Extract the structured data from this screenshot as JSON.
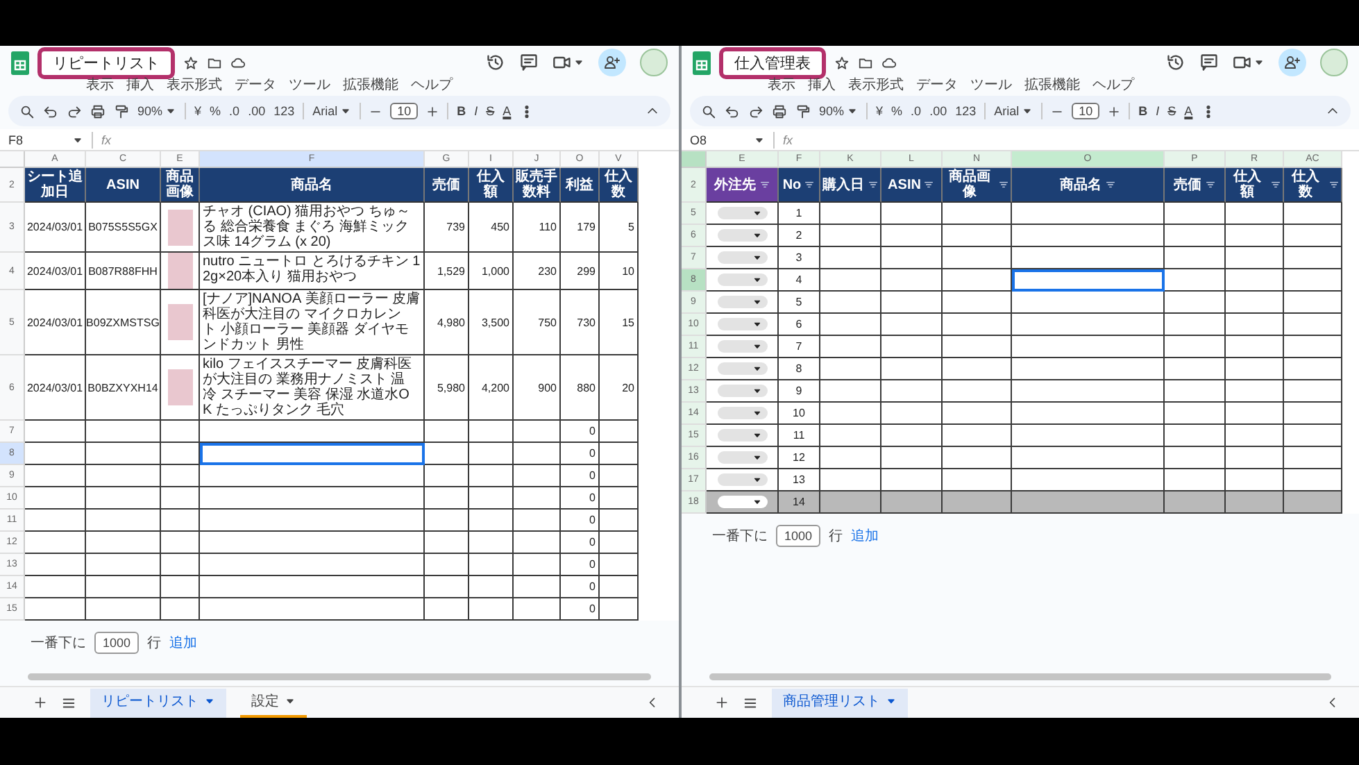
{
  "windows": [
    {
      "title": {
        "text": "リピートリスト",
        "highlighted": true
      },
      "menu": [
        "表示",
        "挿入",
        "表示形式",
        "データ",
        "ツール",
        "拡張機能",
        "ヘルプ"
      ],
      "toolbar": {
        "zoom": "90%",
        "currency": "¥",
        "percent": "%",
        "decrease_decimal": ".0",
        "increase_decimal": ".00",
        "number_format": "123",
        "font": "Arial",
        "font_size": "10",
        "bold": "B",
        "italic": "I",
        "strikethrough": "S",
        "text_color": "A"
      },
      "cell_ref": "F8",
      "fx": "fx",
      "filtered": false,
      "header_row": "2",
      "columns": [
        {
          "letter": "A",
          "header": "シート追加日",
          "kind": "center",
          "selected": false,
          "color": "#1c3f74"
        },
        {
          "letter": "C",
          "header": "ASIN",
          "kind": "center",
          "selected": false,
          "color": "#1c3f74"
        },
        {
          "letter": "E",
          "header": "商品画像",
          "kind": "image",
          "selected": false,
          "color": "#1c3f74"
        },
        {
          "letter": "F",
          "header": "商品名",
          "kind": "wrap",
          "selected": true,
          "color": "#1c3f74"
        },
        {
          "letter": "G",
          "header": "売価",
          "kind": "number",
          "selected": false,
          "color": "#1c3f74"
        },
        {
          "letter": "I",
          "header": "仕入額",
          "kind": "number",
          "selected": false,
          "color": "#1c3f74"
        },
        {
          "letter": "J",
          "header": "販売手数料",
          "kind": "number",
          "selected": false,
          "color": "#1c3f74"
        },
        {
          "letter": "O",
          "header": "利益",
          "kind": "number",
          "selected": false,
          "color": "#1c3f74"
        },
        {
          "letter": "V",
          "header": "仕入数",
          "kind": "number",
          "selected": false,
          "color": "#1c3f74"
        }
      ],
      "rows": [
        {
          "num": "3",
          "selected": false,
          "image": true,
          "cells": [
            "2024/03/01",
            "B075S5S5GX",
            null,
            "チャオ (CIAO) 猫用おやつ ちゅ～る 総合栄養食 まぐろ 海鮮ミックス味 14グラム (x 20)",
            "739",
            "450",
            "110",
            "179",
            "5"
          ]
        },
        {
          "num": "4",
          "selected": false,
          "image": true,
          "cells": [
            "2024/03/01",
            "B087R88FHH",
            null,
            "nutro ニュートロ とろけるチキン 12g×20本入り 猫用おやつ",
            "1,529",
            "1,000",
            "230",
            "299",
            "10"
          ]
        },
        {
          "num": "5",
          "selected": false,
          "image": true,
          "cells": [
            "2024/03/01",
            "B09ZXMSTSG",
            null,
            "[ナノア]NANOA 美顔ローラー 皮膚科医が大注目の マイクロカレント 小顔ローラー 美顔器 ダイヤモンドカット 男性",
            "4,980",
            "3,500",
            "750",
            "730",
            "15"
          ]
        },
        {
          "num": "6",
          "selected": false,
          "image": true,
          "cells": [
            "2024/03/01",
            "B0BZXYXH14",
            null,
            "kilo フェイススチーマー 皮膚科医が大注目の 業務用ナノミスト 温冷 スチーマー 美容 保湿 水道水OK たっぷりタンク 毛穴",
            "5,980",
            "4,200",
            "900",
            "880",
            "20"
          ]
        },
        {
          "num": "7",
          "selected": false,
          "cells": [
            null,
            null,
            null,
            null,
            null,
            null,
            null,
            "0",
            null
          ]
        },
        {
          "num": "8",
          "selected": true,
          "cells": [
            null,
            null,
            null,
            null,
            null,
            null,
            null,
            "0",
            null
          ]
        },
        {
          "num": "9",
          "selected": false,
          "cells": [
            null,
            null,
            null,
            null,
            null,
            null,
            null,
            "0",
            null
          ]
        },
        {
          "num": "10",
          "selected": false,
          "cells": [
            null,
            null,
            null,
            null,
            null,
            null,
            null,
            "0",
            null
          ]
        },
        {
          "num": "11",
          "selected": false,
          "cells": [
            null,
            null,
            null,
            null,
            null,
            null,
            null,
            "0",
            null
          ]
        },
        {
          "num": "12",
          "selected": false,
          "cells": [
            null,
            null,
            null,
            null,
            null,
            null,
            null,
            "0",
            null
          ]
        },
        {
          "num": "13",
          "selected": false,
          "cells": [
            null,
            null,
            null,
            null,
            null,
            null,
            null,
            "0",
            null
          ]
        },
        {
          "num": "14",
          "selected": false,
          "cells": [
            null,
            null,
            null,
            null,
            null,
            null,
            null,
            "0",
            null
          ]
        },
        {
          "num": "15",
          "selected": false,
          "cells": [
            null,
            null,
            null,
            null,
            null,
            null,
            null,
            "0",
            null
          ]
        }
      ],
      "add_rows": {
        "prefix": "一番下に",
        "count": "1000",
        "suffix": "行",
        "button": "追加"
      },
      "tabs": [
        {
          "label": "リピートリスト",
          "selected": true
        },
        {
          "label": "設定",
          "selected": false,
          "color": "#f29900"
        }
      ]
    },
    {
      "title": {
        "text": "仕入管理表",
        "highlighted": true
      },
      "menu": [
        "表示",
        "挿入",
        "表示形式",
        "データ",
        "ツール",
        "拡張機能",
        "ヘルプ"
      ],
      "toolbar": {
        "zoom": "90%",
        "currency": "¥",
        "percent": "%",
        "decrease_decimal": ".0",
        "increase_decimal": ".00",
        "number_format": "123",
        "font": "Arial",
        "font_size": "10",
        "bold": "B",
        "italic": "I",
        "strikethrough": "S",
        "text_color": "A"
      },
      "cell_ref": "O8",
      "fx": "fx",
      "filtered": true,
      "header_row": "2",
      "columns": [
        {
          "letter": "E",
          "header": "外注先",
          "kind": "dropdown",
          "selected": false,
          "color": "#6a3fa0"
        },
        {
          "letter": "F",
          "header": "No",
          "kind": "center",
          "selected": false,
          "color": "#1c3f74"
        },
        {
          "letter": "K",
          "header": "購入日",
          "kind": "center",
          "selected": false,
          "color": "#1c3f74"
        },
        {
          "letter": "L",
          "header": "ASIN",
          "kind": "center",
          "selected": false,
          "color": "#1c3f74"
        },
        {
          "letter": "N",
          "header": "商品画像",
          "kind": "image",
          "selected": false,
          "color": "#1c3f74"
        },
        {
          "letter": "O",
          "header": "商品名",
          "kind": "wrap",
          "selected": true,
          "color": "#1c3f74"
        },
        {
          "letter": "P",
          "header": "売価",
          "kind": "number",
          "selected": false,
          "color": "#1c3f74"
        },
        {
          "letter": "R",
          "header": "仕入額",
          "kind": "number",
          "selected": false,
          "color": "#1c3f74"
        },
        {
          "letter": "AC",
          "header": "仕入数",
          "kind": "number",
          "selected": false,
          "color": "#1c3f74"
        }
      ],
      "rows": [
        {
          "num": "5",
          "selected": false,
          "shaded": false,
          "cells": [
            null,
            "1",
            null,
            null,
            null,
            null,
            null,
            null,
            null
          ]
        },
        {
          "num": "6",
          "selected": false,
          "shaded": false,
          "cells": [
            null,
            "2",
            null,
            null,
            null,
            null,
            null,
            null,
            null
          ]
        },
        {
          "num": "7",
          "selected": false,
          "shaded": false,
          "cells": [
            null,
            "3",
            null,
            null,
            null,
            null,
            null,
            null,
            null
          ]
        },
        {
          "num": "8",
          "selected": true,
          "shaded": false,
          "cells": [
            null,
            "4",
            null,
            null,
            null,
            null,
            null,
            null,
            null
          ]
        },
        {
          "num": "9",
          "selected": false,
          "shaded": false,
          "cells": [
            null,
            "5",
            null,
            null,
            null,
            null,
            null,
            null,
            null
          ]
        },
        {
          "num": "10",
          "selected": false,
          "shaded": false,
          "cells": [
            null,
            "6",
            null,
            null,
            null,
            null,
            null,
            null,
            null
          ]
        },
        {
          "num": "11",
          "selected": false,
          "shaded": false,
          "cells": [
            null,
            "7",
            null,
            null,
            null,
            null,
            null,
            null,
            null
          ]
        },
        {
          "num": "12",
          "selected": false,
          "shaded": false,
          "cells": [
            null,
            "8",
            null,
            null,
            null,
            null,
            null,
            null,
            null
          ]
        },
        {
          "num": "13",
          "selected": false,
          "shaded": false,
          "cells": [
            null,
            "9",
            null,
            null,
            null,
            null,
            null,
            null,
            null
          ]
        },
        {
          "num": "14",
          "selected": false,
          "shaded": false,
          "cells": [
            null,
            "10",
            null,
            null,
            null,
            null,
            null,
            null,
            null
          ]
        },
        {
          "num": "15",
          "selected": false,
          "shaded": false,
          "cells": [
            null,
            "11",
            null,
            null,
            null,
            null,
            null,
            null,
            null
          ]
        },
        {
          "num": "16",
          "selected": false,
          "shaded": false,
          "cells": [
            null,
            "12",
            null,
            null,
            null,
            null,
            null,
            null,
            null
          ]
        },
        {
          "num": "17",
          "selected": false,
          "shaded": false,
          "cells": [
            null,
            "13",
            null,
            null,
            null,
            null,
            null,
            null,
            null
          ]
        },
        {
          "num": "18",
          "selected": false,
          "shaded": true,
          "cells": [
            null,
            "14",
            null,
            null,
            null,
            null,
            null,
            null,
            null
          ]
        }
      ],
      "add_rows": {
        "prefix": "一番下に",
        "count": "1000",
        "suffix": "行",
        "button": "追加"
      },
      "tabs": [
        {
          "label": "商品管理リスト",
          "selected": true
        }
      ]
    }
  ]
}
